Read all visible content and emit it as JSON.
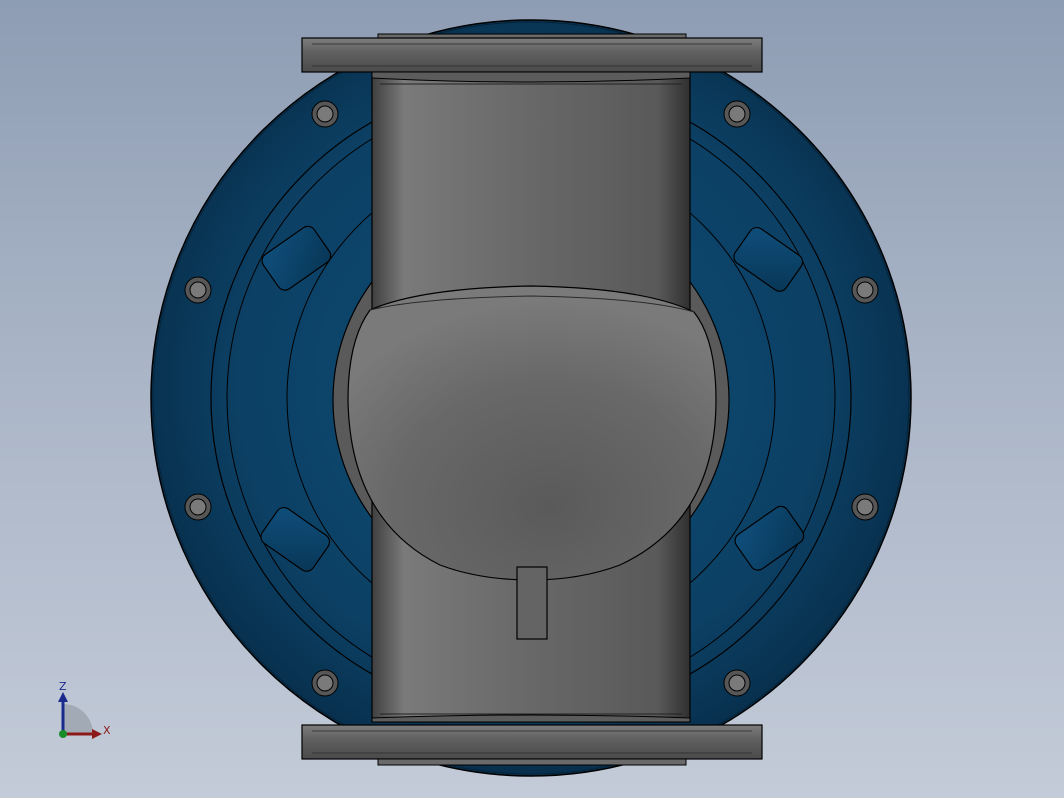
{
  "window": {
    "title": ""
  },
  "triad": {
    "z_label": "Z",
    "x_label": "X",
    "colors": {
      "z": "#1a2a8c",
      "x": "#8c1a1a",
      "origin": "#1a8c2a"
    }
  },
  "model": {
    "icon": "valve-3d-model",
    "colors": {
      "flange_blue": "#0e4468",
      "body_gray": "#6e6e6e",
      "edge": "#101010"
    }
  }
}
